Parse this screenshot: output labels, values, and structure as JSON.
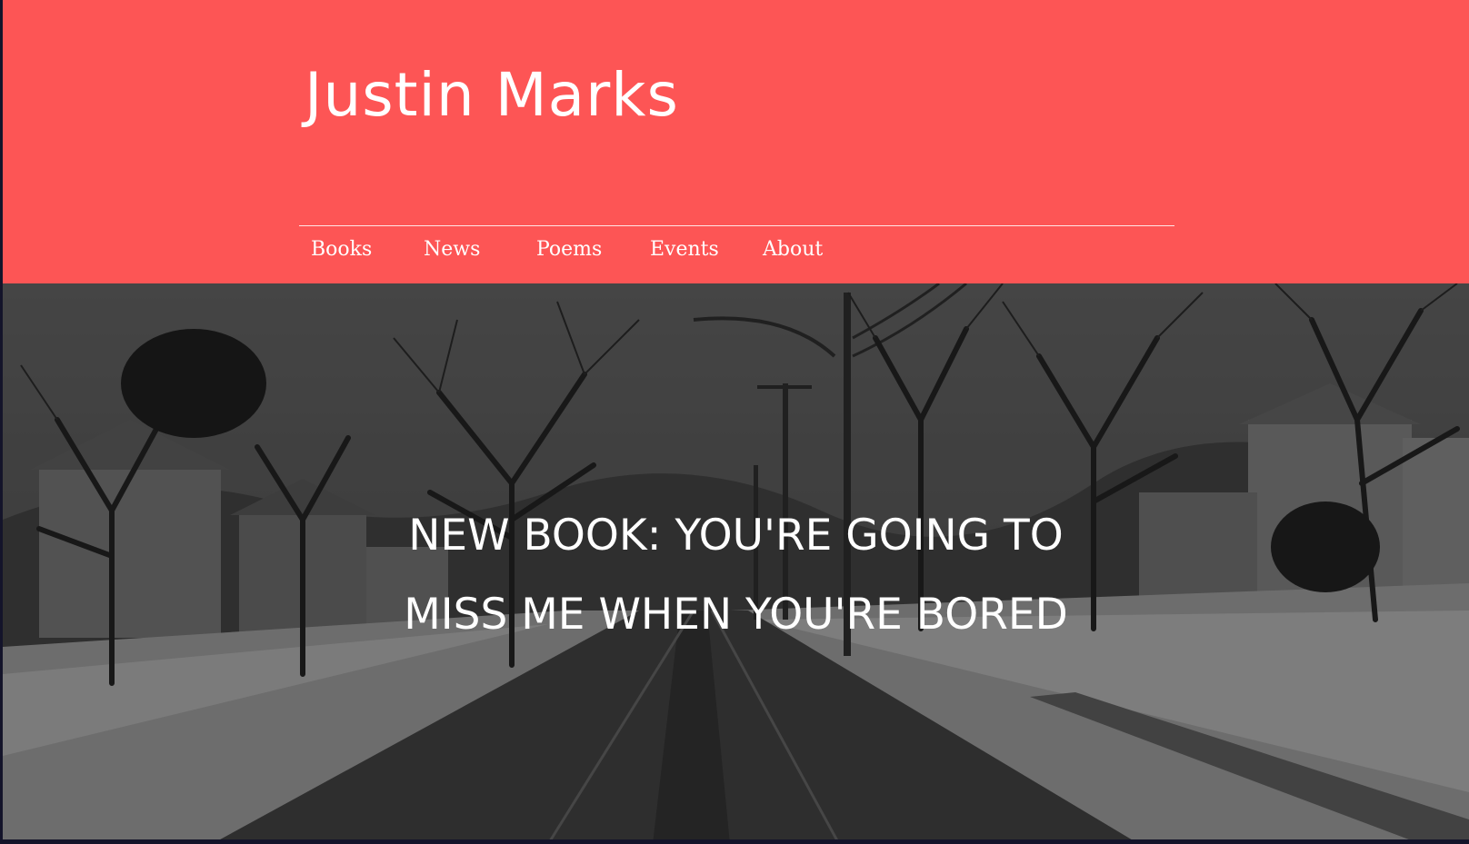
{
  "header": {
    "site_title": "Justin Marks",
    "background_color": "#fd5555"
  },
  "nav": {
    "items": [
      {
        "label": "Books"
      },
      {
        "label": "News"
      },
      {
        "label": "Poems"
      },
      {
        "label": "Events"
      },
      {
        "label": "About"
      }
    ]
  },
  "hero": {
    "headline_line1": "NEW BOOK: YOU'RE GOING TO",
    "headline_line2": "MISS ME WHEN YOU'RE BORED",
    "image_description_icon": "winter-street-photo"
  }
}
